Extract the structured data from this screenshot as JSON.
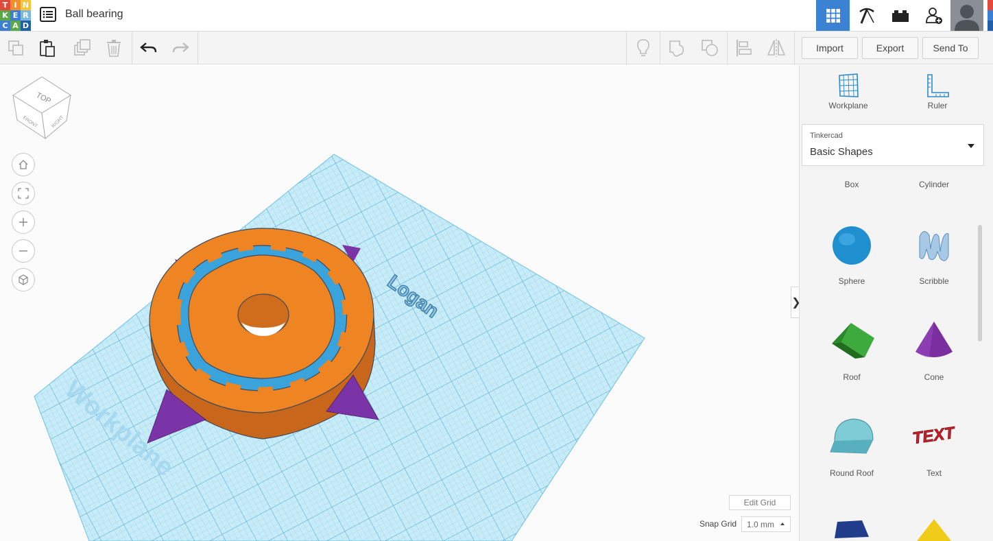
{
  "app": {
    "logo_letters": [
      "T",
      "I",
      "N",
      "K",
      "E",
      "R",
      "C",
      "A",
      "D"
    ],
    "logo_colors": [
      "#e14a3b",
      "#f08d2f",
      "#f7c43d",
      "#5aa846",
      "#3a7fd3",
      "#7ab8e0",
      "#3a7fd3",
      "#5aa846",
      "#1f5fa8"
    ],
    "design_title": "Ball bearing"
  },
  "toolbar": {
    "import_label": "Import",
    "export_label": "Export",
    "send_to_label": "Send To"
  },
  "viewport": {
    "viewcube_top": "TOP",
    "viewcube_front": "FRONT",
    "viewcube_right": "RIGHT",
    "workplane_label": "Workplane",
    "text_object": "Logan",
    "edit_grid_label": "Edit Grid",
    "snap_grid_label": "Snap Grid",
    "snap_grid_value": "1.0 mm",
    "collapse_glyph": "❯"
  },
  "panel": {
    "workplane_label": "Workplane",
    "ruler_label": "Ruler",
    "library_source": "Tinkercad",
    "library_name": "Basic Shapes",
    "shapes": [
      {
        "label": "Box",
        "icon": "box-icon"
      },
      {
        "label": "Cylinder",
        "icon": "cylinder-icon"
      },
      {
        "label": "Sphere",
        "icon": "sphere-icon"
      },
      {
        "label": "Scribble",
        "icon": "scribble-icon"
      },
      {
        "label": "Roof",
        "icon": "roof-icon"
      },
      {
        "label": "Cone",
        "icon": "cone-icon"
      },
      {
        "label": "Round Roof",
        "icon": "round-roof-icon"
      },
      {
        "label": "Text",
        "icon": "text-icon"
      }
    ],
    "text_shape_glyph": "TEXT"
  },
  "colors": {
    "accent": "#3b82d2",
    "orange": "#ee8422",
    "purple": "#7a34a8",
    "workplane": "#9fdcf2"
  }
}
